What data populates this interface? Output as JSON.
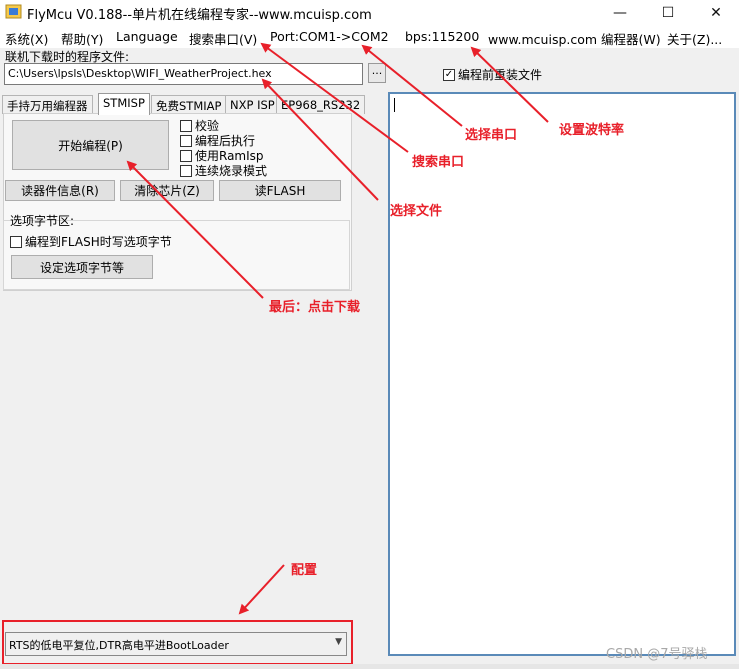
{
  "window": {
    "title": "FlyMcu V0.188--单片机在线编程专家--www.mcuisp.com",
    "minimize_glyph": "—",
    "maximize_glyph": "☐",
    "close_glyph": "✕"
  },
  "menu": [
    "系统(X)",
    "帮助(Y)",
    "Language",
    "搜索串口(V)",
    "Port:COM1->COM2",
    "bps:115200",
    "www.mcuisp.com 编程器(W)",
    "关于(Z)..."
  ],
  "file": {
    "label": "联机下载时的程序文件:",
    "path": "C:\\Users\\lpsls\\Desktop\\WIFI_WeatherProject.hex",
    "browse_label": "...",
    "reload_label": "编程前重装文件",
    "reload_checked": true
  },
  "tabs": [
    "手持万用编程器",
    "STMISP",
    "免费STMIAP",
    "NXP ISP",
    "EP968_RS232"
  ],
  "active_tab": "STMISP",
  "stmisp": {
    "start_button": "开始编程(P)",
    "options": [
      {
        "label": "校验",
        "checked": false
      },
      {
        "label": "编程后执行",
        "checked": false
      },
      {
        "label": "使用RamIsp",
        "checked": false
      },
      {
        "label": "连续烧录模式",
        "checked": false
      }
    ],
    "read_info_button": "读器件信息(R)",
    "erase_button": "清除芯片(Z)",
    "read_flash_button": "读FLASH",
    "option_bytes_group": "选项字节区:",
    "write_option_label": "编程到FLASH时写选项字节",
    "write_option_checked": false,
    "set_option_button": "设定选项字节等"
  },
  "reset_mode": {
    "selected": "RTS的低电平复位,DTR高电平进BootLoader"
  },
  "annotations": {
    "select_port": "选择串口",
    "set_baud": "设置波特率",
    "search_port": "搜索串口",
    "select_file": "选择文件",
    "final_download": "最后：点击下载",
    "config": "配置"
  },
  "watermark": "CSDN @7号驿栈",
  "colors": {
    "annotation": "#e8202a",
    "log_border": "#5a8ab8"
  }
}
